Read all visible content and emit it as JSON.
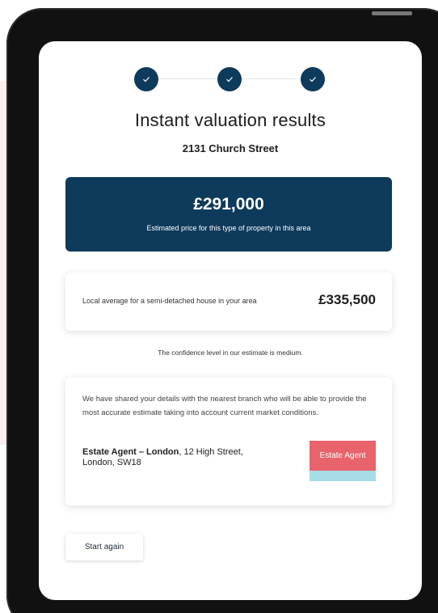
{
  "stepper": {
    "steps": [
      "complete",
      "complete",
      "complete"
    ],
    "icon": "check-icon"
  },
  "results": {
    "title": "Instant valuation results",
    "address": "2131 Church Street"
  },
  "estimate": {
    "price": "£291,000",
    "description": "Estimated price for this type of property in this area"
  },
  "local_average": {
    "description": "Local average for a semi-detached house in your area",
    "price": "£335,500"
  },
  "confidence": "The confidence level in our estimate is medium.",
  "agent": {
    "message": "We have shared your details with the nearest branch who will be able to provide the most accurate estimate taking into account current market conditions.",
    "name": "Estate Agent – London",
    "address_line1": ", 12 High Street,",
    "address_line2": "London, SW18",
    "logo_text": "Estate Agent"
  },
  "actions": {
    "start_again": "Start again"
  },
  "colors": {
    "navy": "#0e3a5c",
    "logo_red": "#e8636c",
    "logo_teal": "#a6dde6"
  }
}
